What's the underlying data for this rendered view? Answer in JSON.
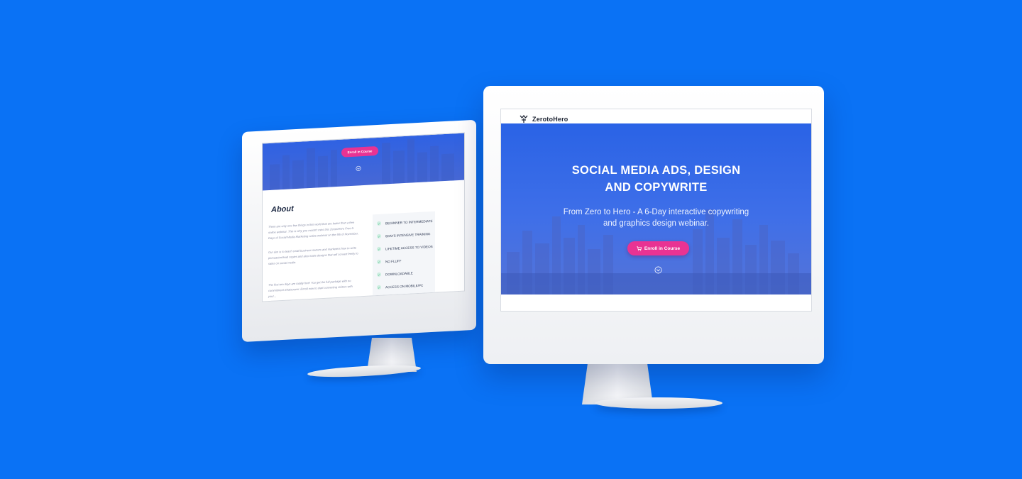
{
  "colors": {
    "background": "#0a72f5",
    "hero_blue": "#2a63e6",
    "enroll_pink": "#e93393",
    "feature_check": "#38b07a"
  },
  "icons": {
    "logo": "zerotohero-logo-icon",
    "cart": "cart-icon",
    "scroll": "chevron-down-circle-icon",
    "check": "check-icon"
  },
  "main_screen": {
    "brand": "ZerotoHero",
    "hero_title_line1": "SOCIAL MEDIA ADS, DESIGN",
    "hero_title_line2": "AND COPYWRITE",
    "hero_subtitle": "From Zero to Hero - A 6-Day interactive copywriting and graphics design webinar.",
    "enroll_label": "Enroll in Course"
  },
  "side_screen": {
    "enroll_label": "Enroll in Course",
    "about_title": "About",
    "paragraphs": [
      "There are only one few things in this world that are better than a free online webinar. This is why you mustn't miss this ZerotoHero Free 6-Days of Social Media Marketing online webinar on the 9th of November.",
      "Our aim is to teach small business owners and marketers how to write persuasive/lead copies and also make designs that will convert freely to sales on social media.",
      "The first two days are totally free! You get the full package with no commitment whatsoever. Enroll now to start converting visitors with your..."
    ],
    "features": [
      "BEGINNER TO INTERMEDIATE",
      "6DAYS INTENSIVE TRAINING",
      "LIFETIME ACCESS TO VIDEOS",
      "NO FLUFF",
      "DOWNLOADABLE",
      "ACCESS ON MOBILE/PC"
    ]
  }
}
